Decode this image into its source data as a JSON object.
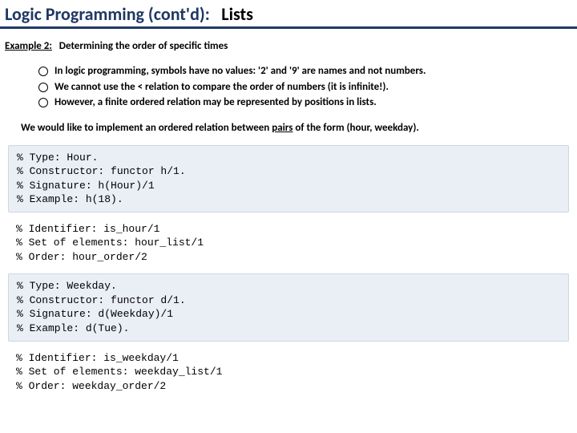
{
  "title": {
    "prefix": "Logic Programming (cont'd):",
    "suffix": "Lists"
  },
  "subhead": {
    "label": "Example 2:",
    "text": "Determining the order of specific times"
  },
  "bullets": [
    "In logic programming, symbols have no values: '2' and '9' are names and not numbers.",
    "We cannot use the < relation to compare the order of numbers (it is infinite!).",
    "However, a finite ordered relation may be represented by positions in lists."
  ],
  "desire": {
    "pre": "We would like to implement an ordered relation between ",
    "u": "pairs",
    "post": " of the form (hour, weekday)."
  },
  "code": {
    "block1": "% Type: Hour.\n% Constructor: functor h/1.\n% Signature: h(Hour)/1\n% Example: h(18).",
    "plain1": "% Identifier: is_hour/1\n% Set of elements: hour_list/1\n% Order: hour_order/2",
    "block2": "% Type: Weekday.\n% Constructor: functor d/1.\n% Signature: d(Weekday)/1\n% Example: d(Tue).",
    "plain2": "% Identifier: is_weekday/1\n% Set of elements: weekday_list/1\n% Order: weekday_order/2"
  }
}
